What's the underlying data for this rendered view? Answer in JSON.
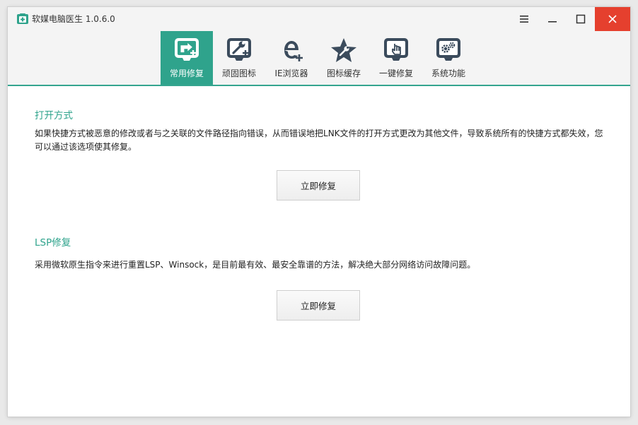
{
  "window": {
    "title": "软媒电脑医生 1.0.6.0"
  },
  "toolbar": {
    "items": [
      {
        "label": "常用修复",
        "icon": "shortcut-repair-icon",
        "active": true
      },
      {
        "label": "顽固图标",
        "icon": "wrench-icon",
        "active": false
      },
      {
        "label": "IE浏览器",
        "icon": "ie-browser-icon",
        "active": false
      },
      {
        "label": "图标缓存",
        "icon": "star-wrench-icon",
        "active": false
      },
      {
        "label": "一键修复",
        "icon": "hand-click-icon",
        "active": false
      },
      {
        "label": "系统功能",
        "icon": "gears-icon",
        "active": false
      }
    ]
  },
  "sections": [
    {
      "title": "打开方式",
      "description_line1": "如果快捷方式被恶意的修改或者与之关联的文件路径指向错误，从而错误地把LNK文件的打开方式更改为其他文件，导致系统所有的快捷方式都失效，您",
      "description_line2": "可以通过该选项使其修复。",
      "button_label": "立即修复"
    },
    {
      "title": "LSP修复",
      "description_line1": "采用微软原生指令来进行重置LSP、Winsock，是目前最有效、最安全靠谱的方法，解决绝大部分网络访问故障问题。",
      "button_label": "立即修复"
    }
  ],
  "colors": {
    "accent": "#2fa38c",
    "close_button": "#e5402e",
    "icon_dark": "#3b4b5c"
  }
}
